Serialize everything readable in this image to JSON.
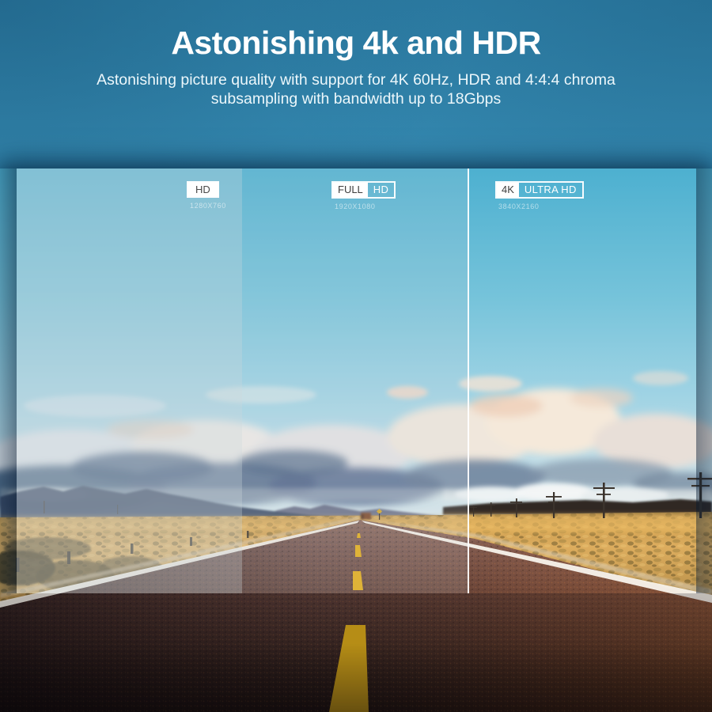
{
  "hero": {
    "title": "Astonishing 4k and HDR",
    "subtitle_line1": "Astonishing picture quality with support for 4K 60Hz, HDR and 4:4:4 chroma",
    "subtitle_line2": "subsampling with bandwidth up to 18Gbps"
  },
  "comparison": {
    "sections": [
      {
        "badge_primary": "HD",
        "badge_secondary": "",
        "resolution": "1280X760"
      },
      {
        "badge_primary": "FULL",
        "badge_secondary": "HD",
        "resolution": "1920X1080"
      },
      {
        "badge_primary": "4K",
        "badge_secondary": "ULTRA HD",
        "resolution": "3840X2160"
      }
    ]
  },
  "colors": {
    "background_top": "#2e80a8",
    "background_bottom": "#4cadd2",
    "headline_text": "#ffffff",
    "badge_background": "#ffffff",
    "badge_text": "#454545",
    "badge_border": "#ffffff",
    "resolution_text": "rgba(255,255,255,0.55)",
    "section_divider": "#ffffff",
    "sky_cyan": "#55b6d4",
    "desert_gold": "#d3a45a",
    "road_line_yellow": "#e2ac17"
  }
}
